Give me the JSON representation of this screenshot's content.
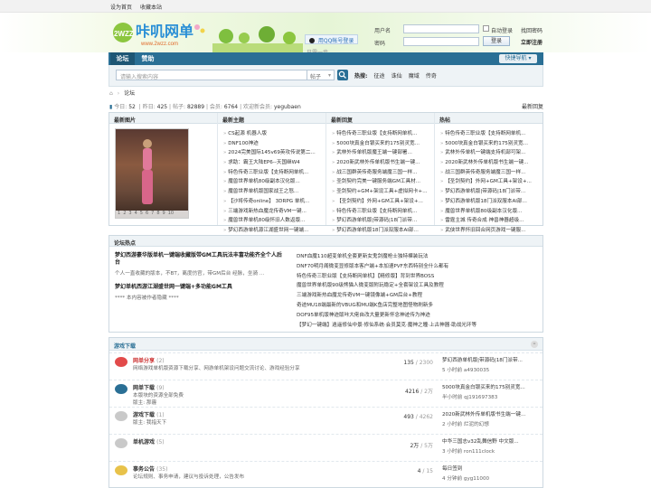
{
  "topbar": {
    "set_home": "设为首页",
    "favorite": "收藏本站"
  },
  "header": {
    "logo_text": "咔叽网单",
    "logo_sub": "2WZZ",
    "logo_url": "www.2wzz.com",
    "qq_login": "用QQ帐号登录",
    "qq_hint": "只需一步，",
    "username_label": "用户名",
    "password_label": "密码",
    "auto_login": "自动登录",
    "forgot": "找回密码",
    "login_btn": "登录",
    "register_btn": "立即注册"
  },
  "nav": {
    "tabs": [
      "论坛",
      "赞助"
    ],
    "quick_nav": "快捷导航"
  },
  "search": {
    "placeholder": "请输入搜索内容",
    "scope": "帖子",
    "hot_label": "热搜:",
    "hot_terms": [
      "征途",
      "诛仙",
      "魔域",
      "传奇"
    ]
  },
  "breadcrumb": {
    "current": "论坛"
  },
  "stats": {
    "today_label": "今日:",
    "today": "52",
    "yesterday_label": "昨日:",
    "yesterday": "425",
    "posts_label": "帖子:",
    "posts": "82889",
    "members_label": "会员:",
    "members": "6764",
    "newest_label": "欢迎新会员:",
    "newest": "yegubaen",
    "latest_reply": "最新回复"
  },
  "portal": {
    "headers": [
      "最新图片",
      "最新主题",
      "最新回复",
      "热帖"
    ],
    "image_pager": [
      "1",
      "2",
      "3",
      "4",
      "5",
      "6",
      "7",
      "8",
      "9",
      "10"
    ],
    "new_topics": [
      "CS起源 机器人版",
      "DNF100神迹",
      "2024完美国际145v69英攻传说第二...",
      "求助：霸王大陆EP6--天国继W4",
      "特色传奇三职业版【支持断网单机...",
      "魔兽世界单机80级副本汉化版...",
      "魔兽世界单机版国家战王之怒...",
      "【沙将传奇online】 3DRPG 单机...",
      "三端游戏新热血魔龙传奇VM一键...",
      "魔兽世界单机80级怀旧人数返版...",
      "梦幻西游单机源江湖盛世网一键端..."
    ],
    "new_replies": [
      "特色传奇三职业版【支持断网单机...",
      "5000块真金白银买来的175别灵宽...",
      "武林外传单机版魔王端一键部署...",
      "2020新武林外传单机版书生端一键...",
      "战三国群英传奇服务端魔三国一样...",
      "圣剑契约完美一键服务端GM工具材...",
      "圣剑契约+GM+架设工具+虚拟网卡+...",
      "【圣剑契约】外网+GM工具+架设+...",
      "特色传奇三职业版【支持断网单机...",
      "梦幻西游单机版|带源码|18门派带...",
      "梦幻西游单机版18门派双服本AI部..."
    ],
    "hot_posts": [
      "特色传奇三职业版【支持断网单机...",
      "5000块真金白银买来的175别灵宽...",
      "武林外传单机一键端支持机部可架...",
      "2020新武林外传单机版书生端一键...",
      "战三国群英传奇服务端魔三国一样...",
      "【圣剑契约】外网+GM工具+架设+...",
      "梦幻西游单机版|带源码|18门派带...",
      "梦幻西游单机版18门派双服本AI部...",
      "魔兽世界单机版80级副本汉化版...",
      "雷霆主城 传奇合成 神兽神器超级...",
      "武侠世界怀旧回合网页游戏一键服..."
    ]
  },
  "hot_section": {
    "title": "论坛热点",
    "featured": [
      {
        "title": "梦幻西游豪华版单机一键端收藏版带GM工具玩法丰富功能齐全个人后台",
        "desc": "个人一直收藏的版本，不BT，离度仿官，带GM后台 经脉，坐骑 ..."
      },
      {
        "title": "梦幻单机西游江湖盛世网一键端+多功能GM工具",
        "desc": "**** 本内容被作者隐藏 ****"
      }
    ],
    "list": [
      "DNF血魔110超变单机全套更新女鬼剑魔枪士独特裸装玩法",
      "DNF70明月阁微变显修版本客户端+本加速PVF东西特别全什么都有",
      "特色传奇三职业版【支持断网单机】【精修版】背到世界BOSS",
      "魔兽世界单机版90级熊猫人微变版附玩稳定+全套架设工具及教程",
      "三端游戏新热血魔龙传奇VM一键镜像端+GM后台+教程",
      "奇迹MU18端最新的VBUG和MU端K鱼店完整地图怪物刷新多",
      "DOF95单机版神迹版咔大佬自改大量更新怀念神迹传为神迹",
      "【梦幻一键端】逍遥修仙中景·修仙系统·会员莫克·魔神之瞳·上古神器·助战光环等"
    ]
  },
  "forums": {
    "section_title": "游戏下载",
    "items": [
      {
        "name": "网单分享",
        "count_paren": "(2)",
        "desc": "网络游戏单机版资源下载分享、网游单机架设问题交流讨论、游戏经验分享",
        "count": "135",
        "count_sub": "2300",
        "last_title": "梦幻西游单机版|带源码|18门派带...",
        "last_meta": "5 小时前 a4930035",
        "icon_color": "#e24a4a"
      },
      {
        "name": "网单下载",
        "count_paren": "(9)",
        "desc": "本版块的资源全部免费",
        "mod_label": "版主:",
        "mod": "那霾",
        "count": "4216",
        "count_sub": "2万",
        "last_title": "5000块真金白银买来的175别灵宽...",
        "last_meta": "半小时前 qj19169738​3",
        "icon_color": "#2a6f95"
      },
      {
        "name": "游戏下载",
        "count_paren": "(1)",
        "desc": "版主: 我指天下",
        "count": "493",
        "count_sub": "4262",
        "last_title": "2020新武林外传单机版书生端一键...",
        "last_meta": "2 小时前 烂泥的幻想",
        "icon_color": "#c9c9c9"
      },
      {
        "name": "单机游戏",
        "count_paren": "(5)",
        "desc": "",
        "count": "2万",
        "count_sub": "5万",
        "last_title": "中华三国志v32乱舞信野 中文版...",
        "last_meta": "3 小时前 ron111clock",
        "icon_color": "#c9c9c9"
      },
      {
        "name": "事务公告",
        "count_paren": "(35)",
        "desc": "论坛规则、事务申请，建议与投诉处理，公告发布",
        "count": "4",
        "count_sub": "15",
        "last_title": "每日签到",
        "last_meta": "4 分钟前 gyg11000",
        "icon_color": "#e8c24a"
      }
    ]
  },
  "colors": {
    "nav_blue": "#2a6f95",
    "accent_red": "#c33"
  }
}
